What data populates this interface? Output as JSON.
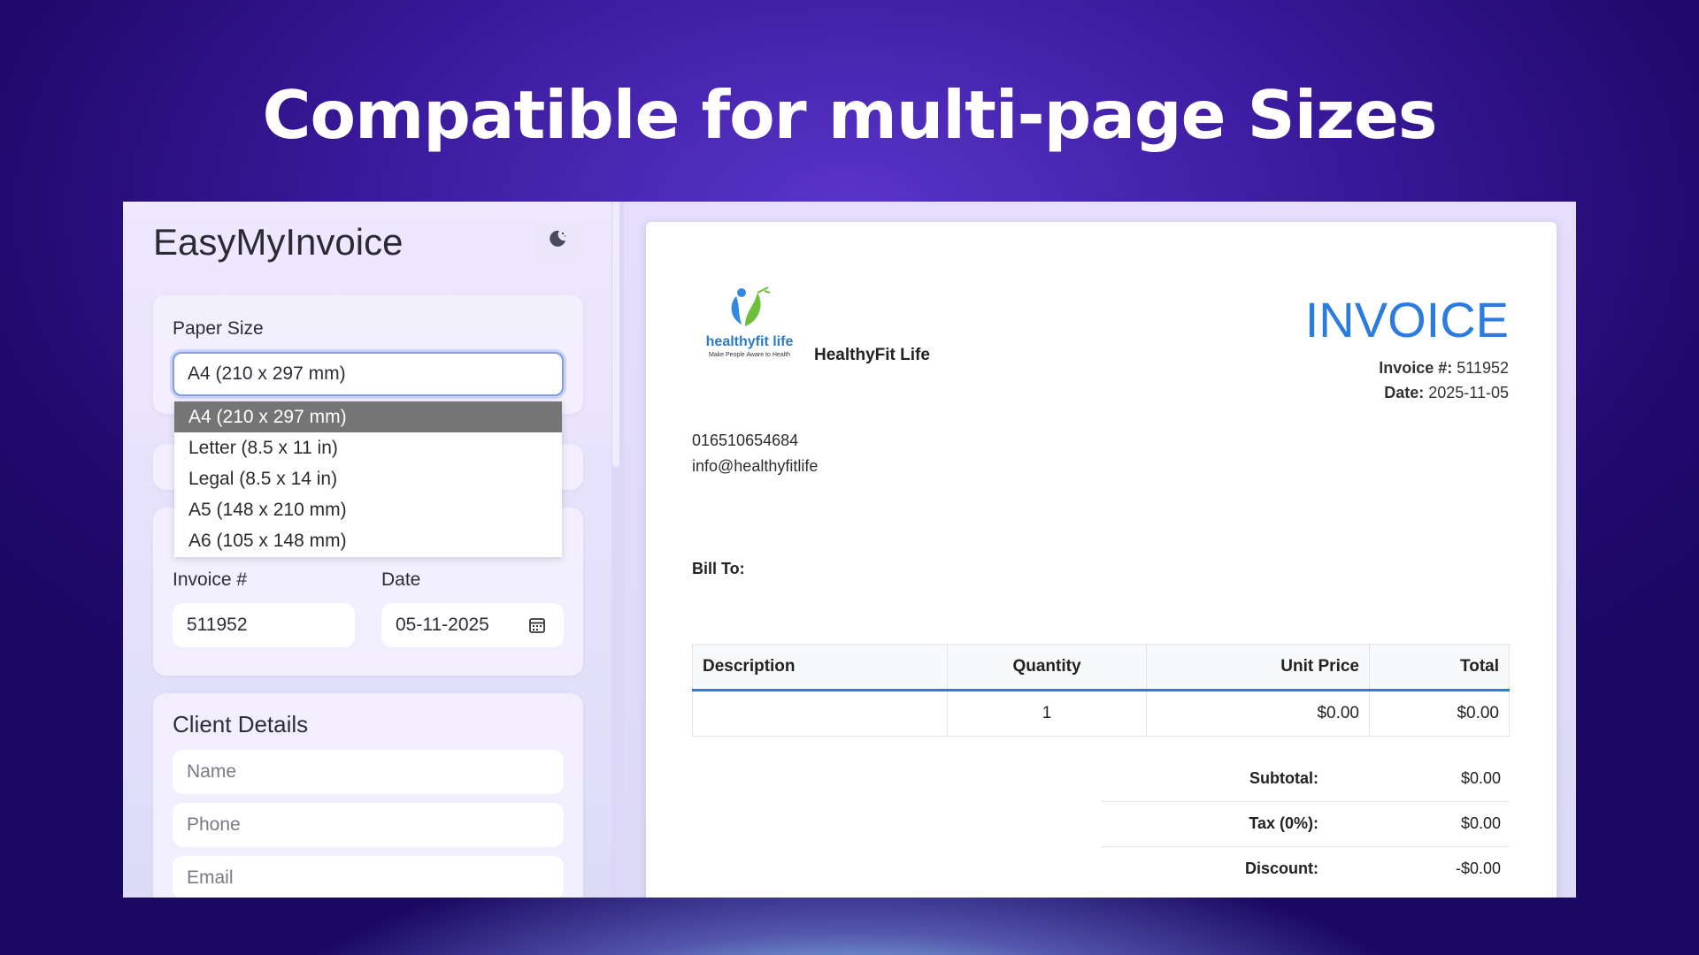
{
  "headline": "Compatible for multi-page Sizes",
  "sidebar": {
    "app_title": "EasyMyInvoice",
    "theme_icon": "moon-icon",
    "paper_size": {
      "label": "Paper Size",
      "selected": "A4 (210 x 297 mm)",
      "options": [
        "A4 (210 x 297 mm)",
        "Letter (8.5 x 11 in)",
        "Legal (8.5 x 14 in)",
        "A5 (148 x 210 mm)",
        "A6 (105 x 148 mm)"
      ]
    },
    "invoice_details": {
      "invoice_label": "Invoice #",
      "invoice_value": "511952",
      "date_label": "Date",
      "date_value": "05-11-2025",
      "date_icon": "calendar-icon"
    },
    "client_details": {
      "title": "Client Details",
      "name_placeholder": "Name",
      "phone_placeholder": "Phone",
      "email_placeholder": "Email"
    }
  },
  "preview": {
    "logo_text": "healthyfit life",
    "logo_tagline": "Make People Aware to Health",
    "company_name": "HealthyFit Life",
    "title": "INVOICE",
    "invoice_no_label": "Invoice #:",
    "invoice_no": "511952",
    "date_label": "Date:",
    "date": "2025-11-05",
    "phone": "016510654684",
    "email": "info@healthyfitlife",
    "bill_to": "Bill To:",
    "table": {
      "headers": [
        "Description",
        "Quantity",
        "Unit Price",
        "Total"
      ],
      "rows": [
        [
          "",
          "1",
          "$0.00",
          "$0.00"
        ]
      ]
    },
    "totals": [
      {
        "label": "Subtotal:",
        "value": "$0.00"
      },
      {
        "label": "Tax (0%):",
        "value": "$0.00"
      },
      {
        "label": "Discount:",
        "value": "-$0.00"
      }
    ],
    "accent_color": "#2b7be0"
  }
}
